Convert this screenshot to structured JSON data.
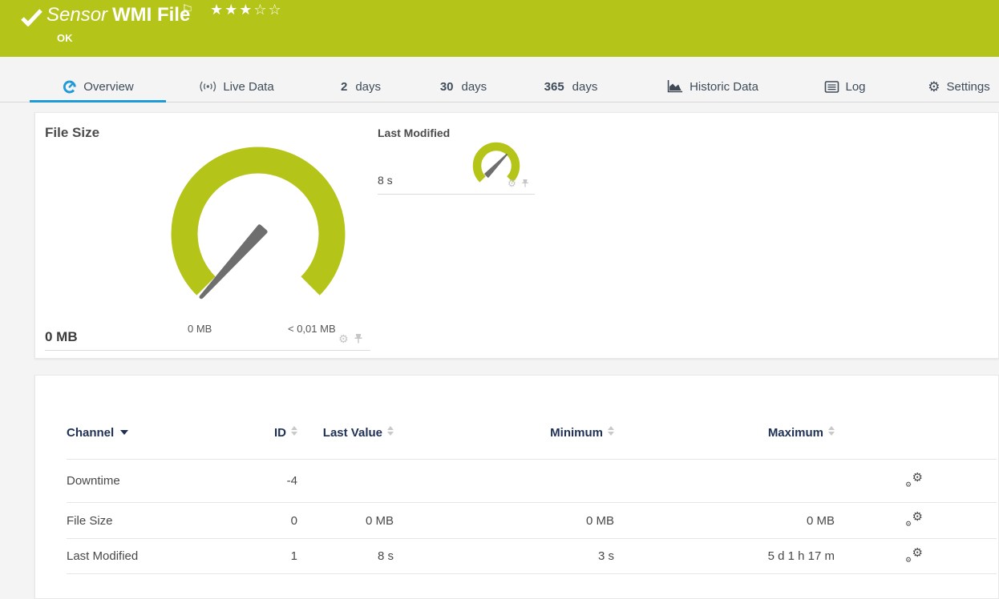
{
  "colors": {
    "status_ok_green": "#b5c418",
    "accent_blue": "#1e9ad8",
    "needle_gray": "#6e6e6e"
  },
  "header": {
    "kind_label": "Sensor",
    "title": "WMI File",
    "status_text": "OK",
    "stars_text": "★★★☆☆",
    "rating": {
      "filled": 3,
      "total": 5
    }
  },
  "tabs": [
    {
      "label": "Overview",
      "icon": "gauge-icon",
      "active": true
    },
    {
      "label": "Live Data",
      "icon": "broadcast-icon",
      "active": false
    },
    {
      "number": "2",
      "label": "days",
      "active": false
    },
    {
      "number": "30",
      "label": "days",
      "active": false
    },
    {
      "number": "365",
      "label": "days",
      "active": false
    },
    {
      "label": "Historic Data",
      "icon": "area-chart-icon",
      "active": false
    },
    {
      "label": "Log",
      "icon": "log-icon",
      "active": false
    },
    {
      "label": "Settings",
      "icon": "gear-icon",
      "active": false
    }
  ],
  "gauges": {
    "primary": {
      "title": "File Size",
      "current_value": "0 MB",
      "scale_min": "0 MB",
      "scale_max": "< 0,01 MB"
    },
    "secondary": {
      "title": "Last Modified",
      "current_value": "8 s"
    }
  },
  "channel_table": {
    "headers": {
      "channel": "Channel",
      "id": "ID",
      "last_value": "Last Value",
      "minimum": "Minimum",
      "maximum": "Maximum"
    },
    "rows": [
      {
        "channel": "Downtime",
        "id": "-4",
        "last_value": "",
        "minimum": "",
        "maximum": ""
      },
      {
        "channel": "File Size",
        "id": "0",
        "last_value": "0 MB",
        "minimum": "0 MB",
        "maximum": "0 MB"
      },
      {
        "channel": "Last Modified",
        "id": "1",
        "last_value": "8 s",
        "minimum": "3 s",
        "maximum": "5 d 1 h 17 m"
      }
    ]
  }
}
